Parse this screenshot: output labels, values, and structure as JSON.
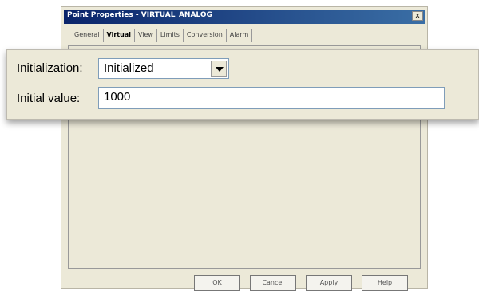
{
  "dialog": {
    "title": "Point Properties - VIRTUAL_ANALOG",
    "close_label": "x",
    "tabs": [
      {
        "label": "General"
      },
      {
        "label": "Virtual"
      },
      {
        "label": "View"
      },
      {
        "label": "Limits"
      },
      {
        "label": "Conversion"
      },
      {
        "label": "Alarm"
      }
    ],
    "buttons": {
      "ok": "OK",
      "cancel": "Cancel",
      "apply": "Apply",
      "help": "Help"
    }
  },
  "virtual": {
    "initialization_label": "Initialization:",
    "initialization_value": "Initialized",
    "initial_value_label": "Initial value:",
    "initial_value": "1000"
  }
}
